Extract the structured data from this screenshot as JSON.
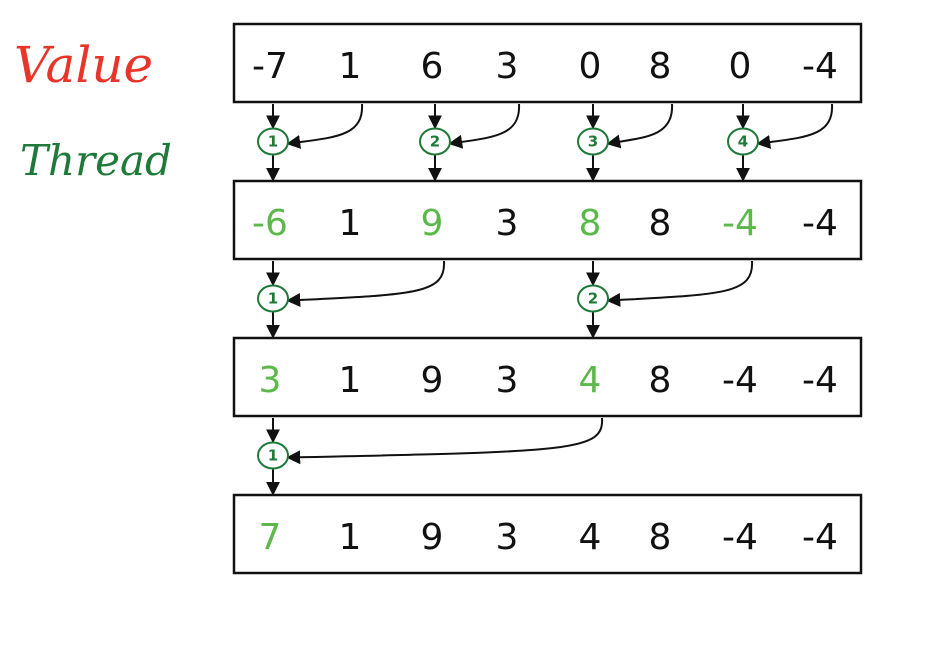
{
  "legend": {
    "value_label": "Value",
    "thread_label": "Thread"
  },
  "colors": {
    "value_label": "#e8352a",
    "thread_label": "#1f7a3a",
    "updated_cell": "#5cb84a",
    "thread_node": "#1f7a3a",
    "ink": "#111111"
  },
  "rows": [
    {
      "cells": [
        "-7",
        "1",
        "6",
        "3",
        "0",
        "8",
        "0",
        "-4"
      ],
      "updated": [
        false,
        false,
        false,
        false,
        false,
        false,
        false,
        false
      ]
    },
    {
      "cells": [
        "-6",
        "1",
        "9",
        "3",
        "8",
        "8",
        "-4",
        "-4"
      ],
      "updated": [
        true,
        false,
        true,
        false,
        true,
        false,
        true,
        false
      ]
    },
    {
      "cells": [
        "3",
        "1",
        "9",
        "3",
        "4",
        "8",
        "-4",
        "-4"
      ],
      "updated": [
        true,
        false,
        false,
        false,
        true,
        false,
        false,
        false
      ]
    },
    {
      "cells": [
        "7",
        "1",
        "9",
        "3",
        "4",
        "8",
        "-4",
        "-4"
      ],
      "updated": [
        true,
        false,
        false,
        false,
        false,
        false,
        false,
        false
      ]
    }
  ],
  "steps": [
    {
      "threads": [
        {
          "id": "1",
          "target": 0,
          "source": 1
        },
        {
          "id": "2",
          "target": 2,
          "source": 3
        },
        {
          "id": "3",
          "target": 4,
          "source": 5
        },
        {
          "id": "4",
          "target": 6,
          "source": 7
        }
      ]
    },
    {
      "threads": [
        {
          "id": "1",
          "target": 0,
          "source": 2
        },
        {
          "id": "2",
          "target": 4,
          "source": 6
        }
      ]
    },
    {
      "threads": [
        {
          "id": "1",
          "target": 0,
          "source": 4
        }
      ]
    }
  ]
}
